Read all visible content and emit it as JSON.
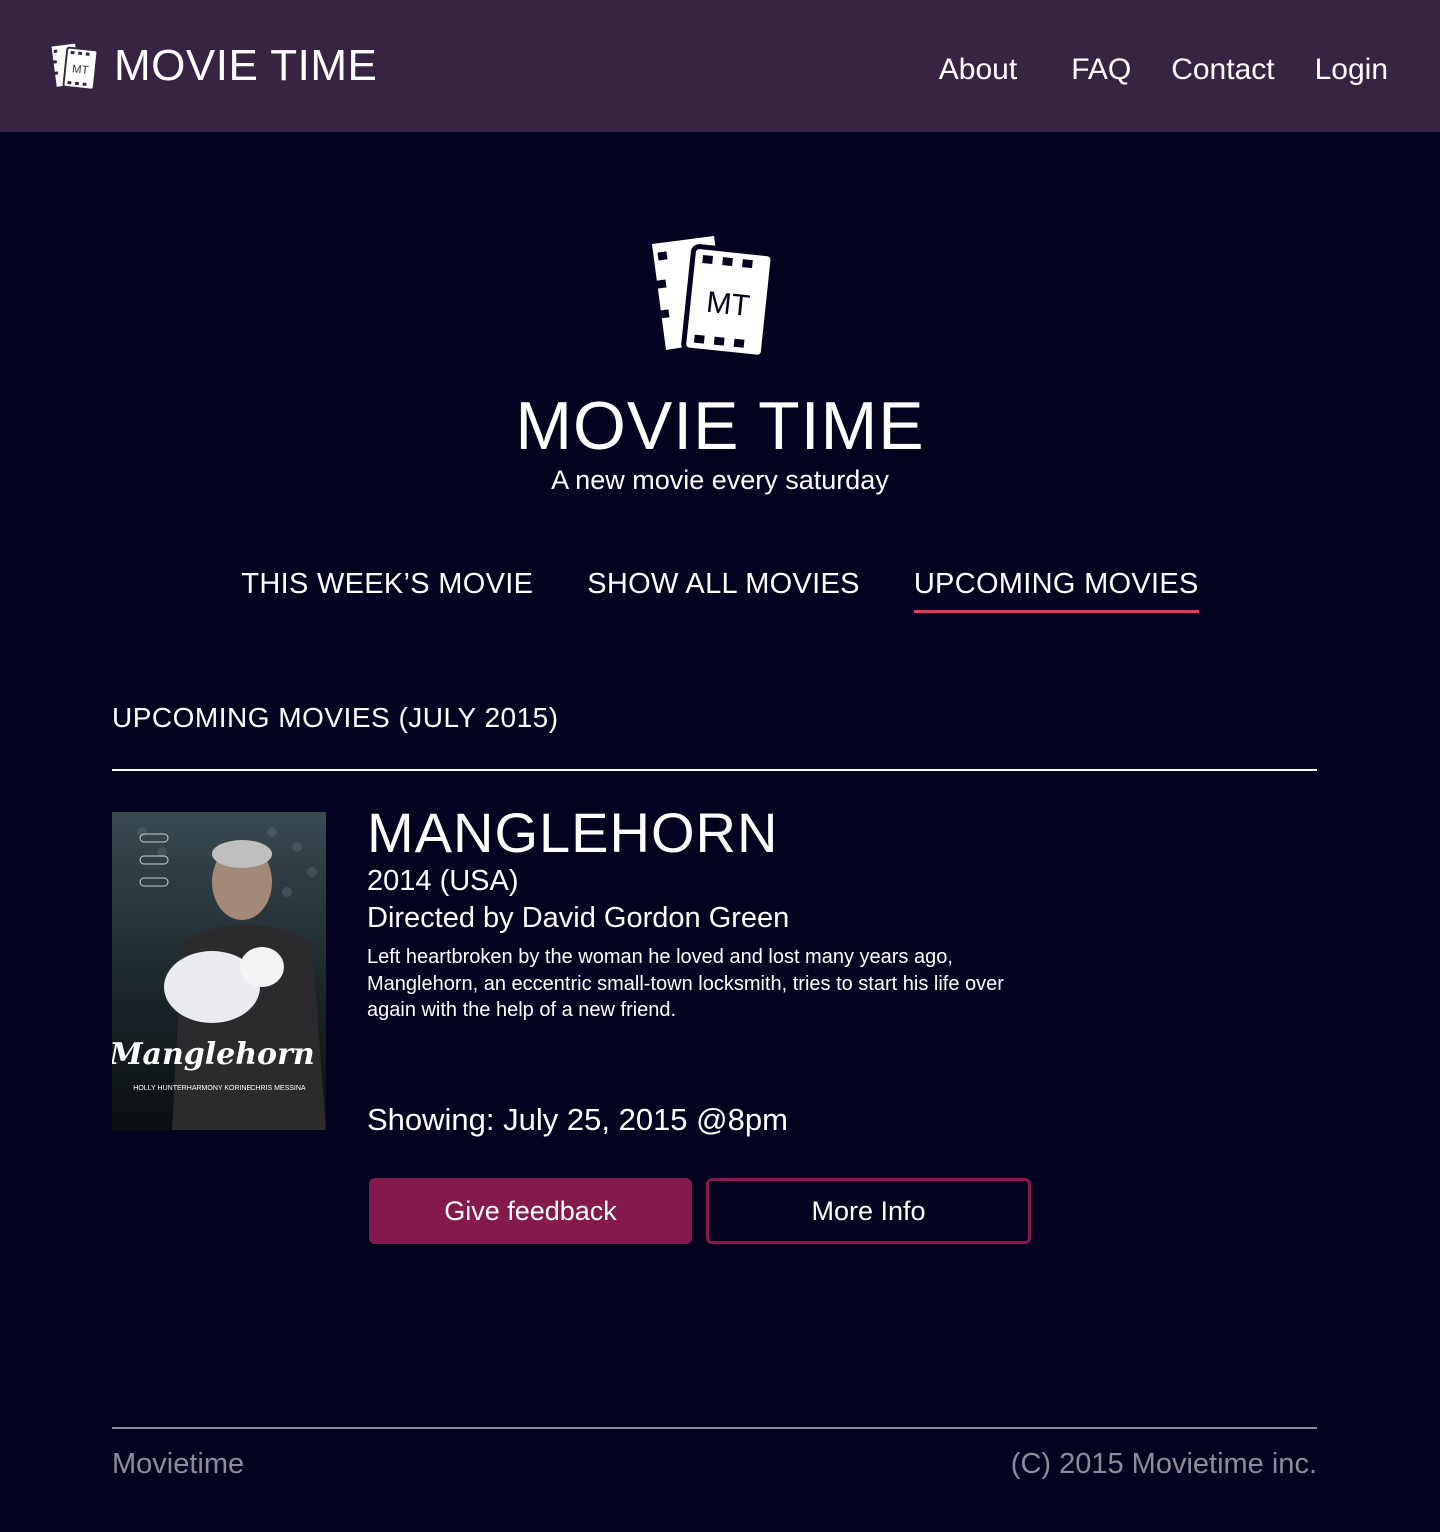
{
  "header": {
    "brand": "MOVIE TIME",
    "nav": [
      {
        "label": "About"
      },
      {
        "label": "FAQ"
      },
      {
        "label": "Contact"
      },
      {
        "label": "Login"
      }
    ]
  },
  "hero": {
    "logo_text": "MT",
    "title": "MOVIE TIME",
    "tagline": "A new movie every saturday"
  },
  "tabs": [
    {
      "label": "THIS WEEK’S MOVIE",
      "active": false
    },
    {
      "label": "SHOW ALL MOVIES",
      "active": false
    },
    {
      "label": "UPCOMING MOVIES",
      "active": true
    }
  ],
  "section": {
    "heading": "UPCOMING  MOVIES (JULY 2015)"
  },
  "movie": {
    "poster": {
      "title_script": "Manglehorn",
      "credits": [
        "HOLLY HUNTER",
        "HARMONY KORINE",
        "CHRIS MESSINA"
      ]
    },
    "title": "MANGLEHORN",
    "year": "2014 (USA)",
    "director": "Directed by David Gordon Green",
    "synopsis": "Left heartbroken by the woman he loved and lost many years ago, Manglehorn, an eccentric small-town locksmith, tries to start his life over again with the help of a new friend.",
    "showing": "Showing: July 25, 2015 @8pm",
    "buttons": {
      "feedback": "Give feedback",
      "more_info": "More Info"
    }
  },
  "footer": {
    "left": "Movietime",
    "right": "(C) 2015 Movietime inc."
  },
  "colors": {
    "page_bg": "#04031f",
    "header_bg": "#372443",
    "accent": "#84194c",
    "tab_underline": "#d0445a",
    "footer_text": "#8e8c9a"
  }
}
